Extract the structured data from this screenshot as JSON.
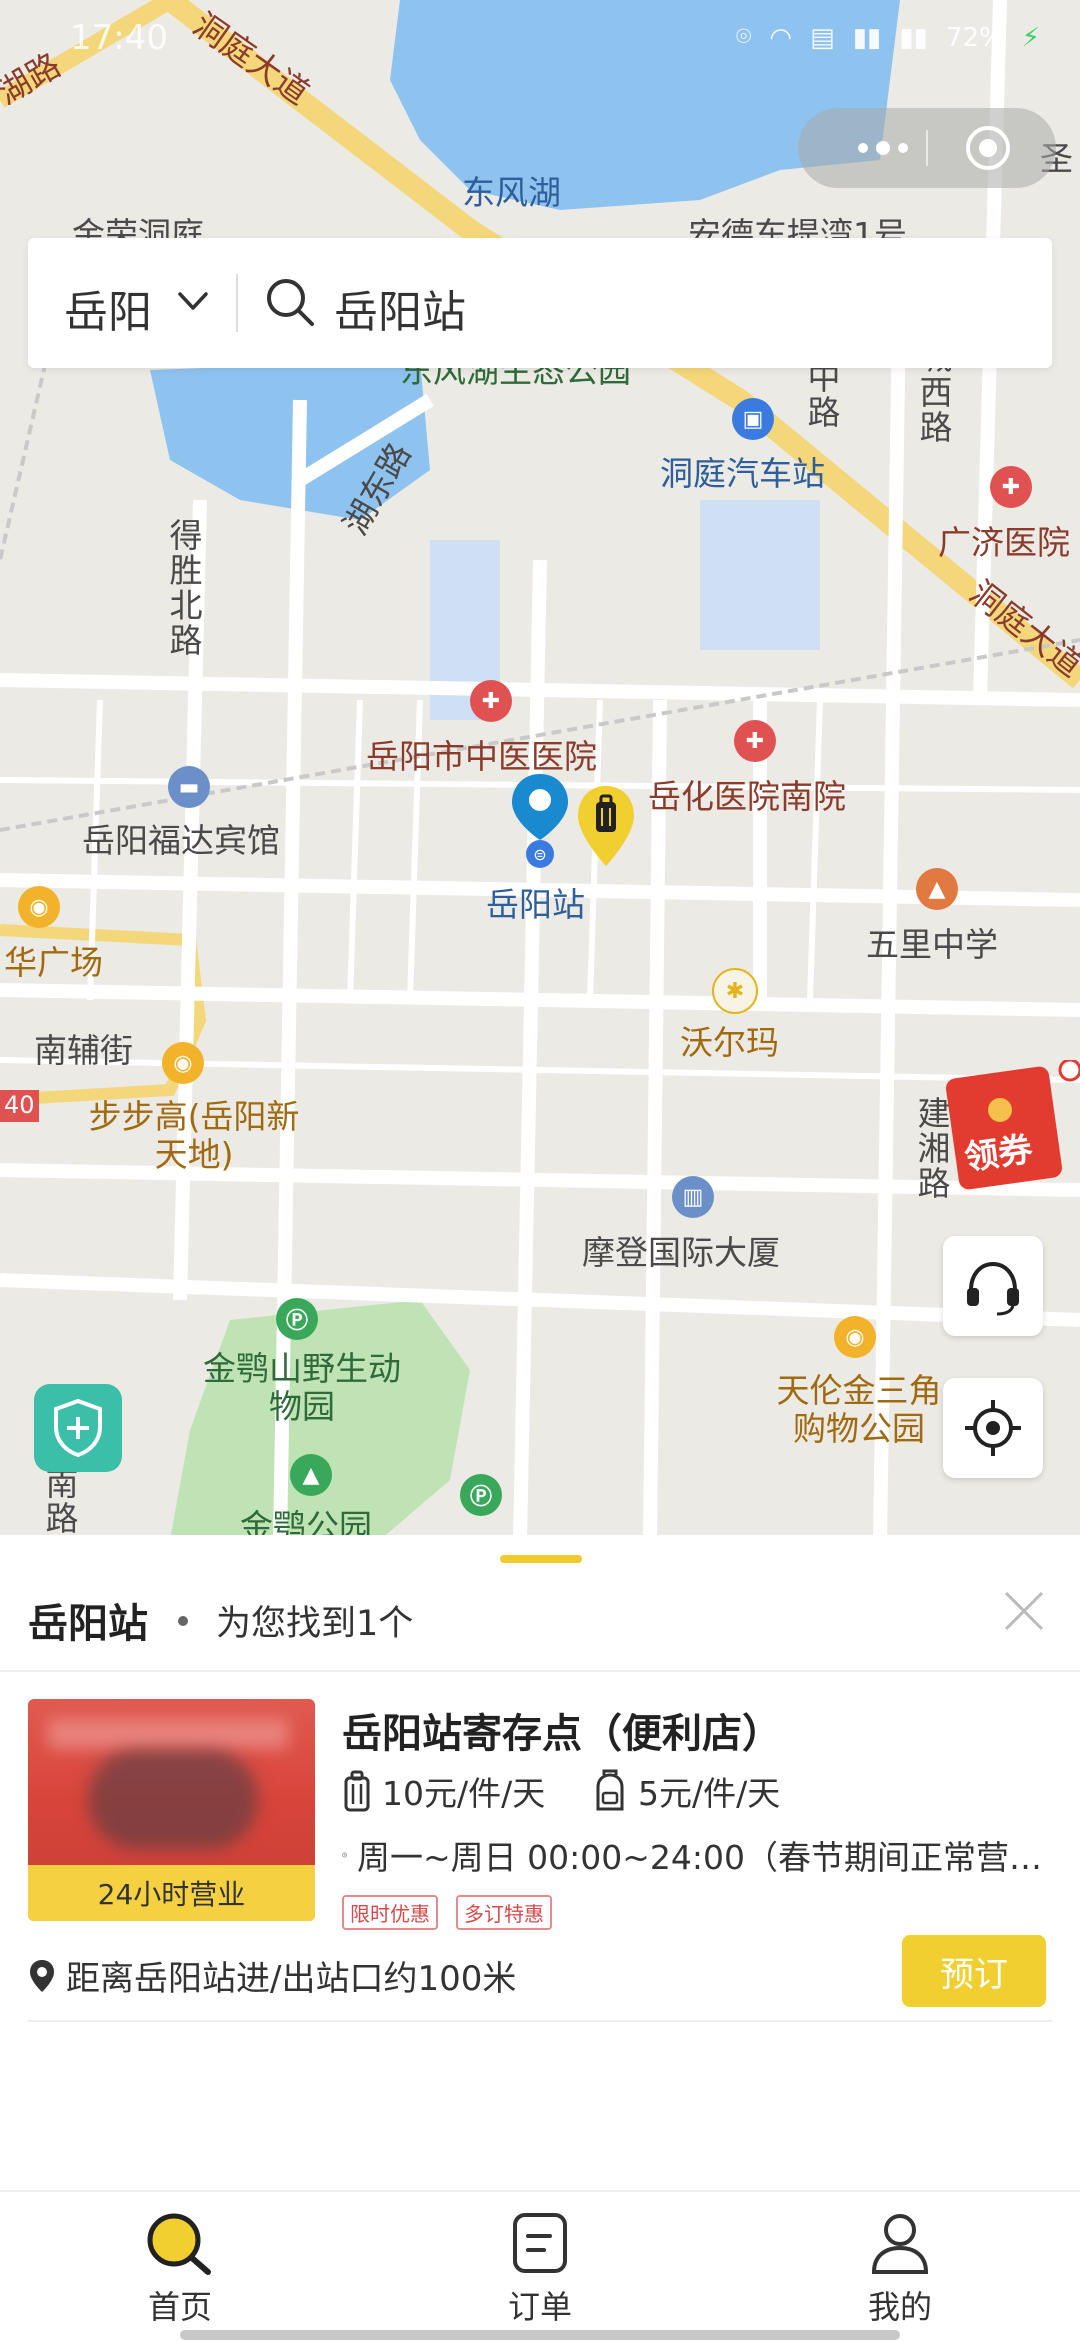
{
  "status_bar": {
    "time": "17:40",
    "battery": "72%"
  },
  "search": {
    "city": "岳阳",
    "query": "岳阳站"
  },
  "map": {
    "labels": {
      "road_dongting_nw": "洞庭大道",
      "road_dongting_se": "洞庭大道",
      "road_hu_nw": "湖路",
      "lake_dongfeng": "东风湖",
      "anding": "安德东提湾1号",
      "jinhua": "金荣洞庭",
      "eco_park": "东风湖生态公园",
      "bus_station": "洞庭汽车站",
      "guangji": "广济医院",
      "hospital_tcm": "岳阳市中医医院",
      "hospital_yuehua": "岳化医院南院",
      "hotel": "岳阳福达宾馆",
      "station": "岳阳站",
      "wuli": "五里中学",
      "plaza": "华广场",
      "nanfu": "南辅街",
      "bubugao": "步步高(岳阳新天地)",
      "walmart": "沃尔玛",
      "modern": "摩登国际大厦",
      "zoo": "金鹗山野生动物园",
      "jine_park": "金鹗公园",
      "tianlun": "天伦金三角购物公园",
      "desheng": "得胜北路",
      "hudong": "湖东路",
      "jianxiang": "建湘路",
      "zhonglu": "中路",
      "chengxi": "城西路",
      "nanlu": "南路",
      "sheng": "圣",
      "n40": "40"
    }
  },
  "buttons": {
    "coupon": "领券"
  },
  "sheet": {
    "title": "岳阳站",
    "found": "为您找到1个",
    "store": {
      "badge": "24小时营业",
      "name": "岳阳站寄存点（便利店）",
      "price_luggage": "10元/件/天",
      "price_bag": "5元/件/天",
      "hours": "周一~周日 00:00~24:00（春节期间正常营…",
      "tag1": "限时优惠",
      "tag2": "多订特惠",
      "distance": "距离岳阳站进/出站口约100米",
      "book": "预订"
    }
  },
  "tabs": [
    {
      "label": "首页"
    },
    {
      "label": "订单"
    },
    {
      "label": "我的"
    }
  ],
  "colors": {
    "accent": "#f2cf30",
    "map_bg": "#eceae4",
    "water": "#8fc3ef",
    "road": "#ffffff",
    "main_road": "#f4d77a"
  }
}
